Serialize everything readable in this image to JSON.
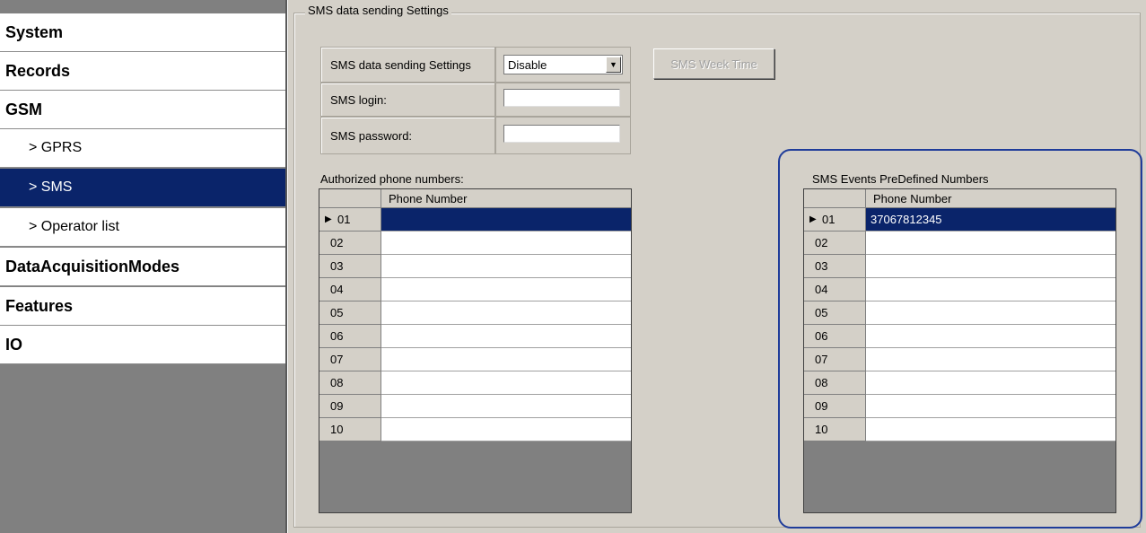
{
  "sidebar": {
    "items": [
      {
        "label": "System",
        "level": "top",
        "active": false
      },
      {
        "label": "Records",
        "level": "top",
        "active": false
      },
      {
        "label": "GSM",
        "level": "top",
        "active": false
      },
      {
        "label": "> GPRS",
        "level": "sub",
        "active": false
      },
      {
        "label": "> SMS",
        "level": "sub",
        "active": true
      },
      {
        "label": "> Operator list",
        "level": "sub",
        "active": false
      },
      {
        "label": "DataAcquisitionModes",
        "level": "top",
        "active": false
      },
      {
        "label": "Features",
        "level": "top",
        "active": false
      },
      {
        "label": "IO",
        "level": "top",
        "active": false
      }
    ]
  },
  "group": {
    "title": "SMS data sending Settings"
  },
  "settings": {
    "sending_label": "SMS data sending Settings",
    "sending_value": "Disable",
    "login_label": "SMS login:",
    "login_value": "",
    "password_label": "SMS password:",
    "password_value": "",
    "week_time_button": "SMS Week Time"
  },
  "authorized": {
    "title": "Authorized phone numbers:",
    "column": "Phone Number",
    "rows": [
      "01",
      "02",
      "03",
      "04",
      "05",
      "06",
      "07",
      "08",
      "09",
      "10"
    ],
    "values": [
      "",
      "",
      "",
      "",
      "",
      "",
      "",
      "",
      "",
      ""
    ],
    "selected_row": "01"
  },
  "predefined": {
    "title": "SMS Events PreDefined Numbers",
    "column": "Phone Number",
    "rows": [
      "01",
      "02",
      "03",
      "04",
      "05",
      "06",
      "07",
      "08",
      "09",
      "10"
    ],
    "values": [
      "37067812345",
      "",
      "",
      "",
      "",
      "",
      "",
      "",
      "",
      ""
    ],
    "selected_row": "01"
  },
  "colors": {
    "selection": "#0a246a",
    "panel": "#d4d0c8",
    "highlight_outline": "#1f3c9a"
  },
  "icons": {
    "row_pointer": "triangle-right-icon",
    "dropdown": "chevron-down-icon"
  }
}
